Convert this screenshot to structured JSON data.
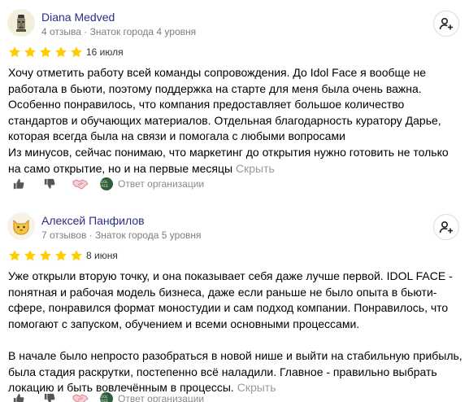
{
  "reviews": [
    {
      "author": "Diana Medved",
      "meta": "4 отзыва · Знаток города 4 уровня",
      "rating": 5,
      "date": "16 июля",
      "paragraphs": [
        "Хочу отметить работу всей команды сопровождения. До Idol Face я вообще не работала в бьюти, поэтому поддержка на старте для меня была очень важна. Особенно понравилось, что компания предоставляет большое количество стандартов и обучающих материалов. Отдельная благодарность куратору Дарье, которая всегда была на связи и помогала с любыми вопросами",
        "Из минусов, сейчас понимаю, что маркетинг до открытия нужно готовить не только на само открытие, но и на первые месяцы"
      ],
      "hide_label": "Скрыть",
      "org_reply_label": "Ответ организации",
      "org_logo_text": "IDOL FACE",
      "avatar_icon": "moai-avatar-icon"
    },
    {
      "author": "Алексей Панфилов",
      "meta": "7 отзывов · Знаток города 5 уровня",
      "rating": 5,
      "date": "8 июня",
      "paragraphs": [
        "Уже открыли вторую точку, и она показывает себя даже лучше первой. IDOL FACE - понятная и рабочая модель бизнеса, даже если раньше не было опыта в бьюти-сфере, понравился формат моностудии и сам подход компании. Понравилось, что помогают с запуском, обучением и всеми основными процессами.",
        "",
        "В начале было непросто разобраться в новой нише и выйти на стабильную прибыль, была стадия раскрутки, постепенно всё наладили. Главное - правильно выбрать локацию и быть вовлечённым в процессы."
      ],
      "hide_label": "Скрыть",
      "org_reply_label": "Ответ организации",
      "org_logo_text": "IDOL FACE",
      "avatar_icon": "cat-avatar-icon"
    }
  ],
  "colors": {
    "author": "#2a2e86",
    "star": "#fc0",
    "muted": "#7d7d7d",
    "org_logo_bg": "#2f5f3a"
  }
}
